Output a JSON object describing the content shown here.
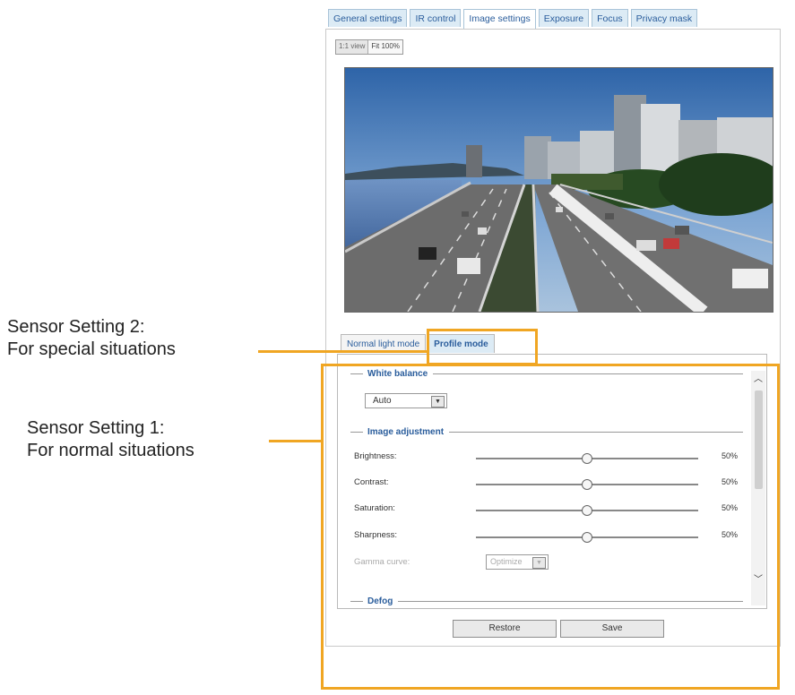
{
  "top_tabs": [
    "General settings",
    "IR control",
    "Image settings",
    "Exposure",
    "Focus",
    "Privacy mask"
  ],
  "active_top_tab": "Image settings",
  "view_toggle": [
    "1:1 view",
    "Fit 100%"
  ],
  "sub_tabs": [
    "Normal light mode",
    "Profile mode"
  ],
  "white_balance": {
    "title": "White balance",
    "value": "Auto"
  },
  "image_adjustment": {
    "title": "Image adjustment",
    "rows": [
      {
        "label": "Brightness:",
        "value": "50%"
      },
      {
        "label": "Contrast:",
        "value": "50%"
      },
      {
        "label": "Saturation:",
        "value": "50%"
      },
      {
        "label": "Sharpness:",
        "value": "50%"
      }
    ],
    "gamma": {
      "label": "Gamma curve:",
      "value": "Optimize"
    }
  },
  "defog": {
    "title": "Defog"
  },
  "buttons": {
    "restore": "Restore",
    "save": "Save"
  },
  "annotations": {
    "setting2_line1": "Sensor Setting 2:",
    "setting2_line2": "For special situations",
    "setting1_line1": "Sensor Setting 1:",
    "setting1_line2": "For normal situations"
  },
  "colors": {
    "highlight": "#f0a623",
    "tab_text": "#2a5d9c",
    "tab_bg": "#dcebf5"
  }
}
